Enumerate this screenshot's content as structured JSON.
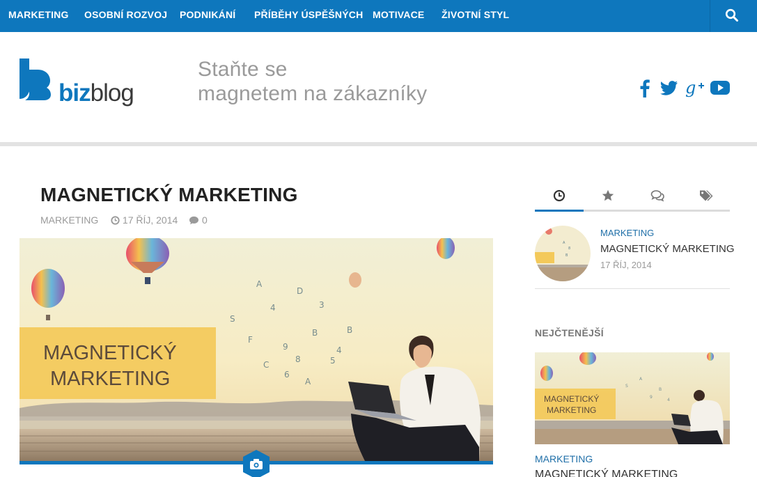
{
  "nav": {
    "items": [
      "MARKETING",
      "OSOBNÍ ROZVOJ",
      "PODNIKÁNÍ",
      "PŘÍBĚHY ÚSPĚŠNÝCH",
      "MOTIVACE",
      "ŽIVOTNÍ STYL"
    ],
    "search_icon": "search-icon"
  },
  "header": {
    "logo": {
      "biz": "biz",
      "blog": "blog"
    },
    "tagline_line1": "Staňte se",
    "tagline_line2": "magnetem na zákazníky",
    "social_icons": [
      "facebook-icon",
      "twitter-icon",
      "google-plus-icon",
      "youtube-icon"
    ]
  },
  "post": {
    "title": "MAGNETICKÝ MARKETING",
    "category": "MARKETING",
    "date": "17 ŘÍJ, 2014",
    "comments": "0",
    "image_text_line1": "MAGNETICKÝ",
    "image_text_line2": "MARKETING"
  },
  "sidebar": {
    "tab_icons": [
      "clock-icon",
      "star-icon",
      "comments-icon",
      "tags-icon"
    ],
    "recent": {
      "category": "MARKETING",
      "title": "MAGNETICKÝ MARKETING",
      "date": "17 ŘÍJ, 2014"
    },
    "popular_heading": "NEJČTENĚJŠÍ",
    "popular": {
      "category": "MARKETING",
      "title": "MAGNETICKÝ MARKETING",
      "image_text_line1": "MAGNETICKÝ",
      "image_text_line2": "MARKETING"
    }
  },
  "colors": {
    "brand_blue": "#0e77bd",
    "nav_text": "#ffffff",
    "meta_gray": "#9a9a9a",
    "image_banner": "#f3c95a"
  }
}
